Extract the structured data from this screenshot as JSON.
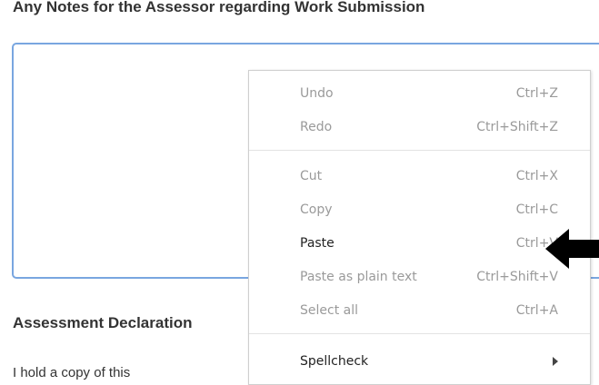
{
  "form": {
    "notes_heading": "Any Notes for the Assessor regarding Work Submission",
    "declaration_heading": "Assessment Declaration",
    "partial_text": "I hold a copy of this"
  },
  "context_menu": {
    "groups": [
      [
        {
          "label": "Undo",
          "shortcut": "Ctrl+Z",
          "enabled": false
        },
        {
          "label": "Redo",
          "shortcut": "Ctrl+Shift+Z",
          "enabled": false
        }
      ],
      [
        {
          "label": "Cut",
          "shortcut": "Ctrl+X",
          "enabled": false
        },
        {
          "label": "Copy",
          "shortcut": "Ctrl+C",
          "enabled": false
        },
        {
          "label": "Paste",
          "shortcut": "Ctrl+V",
          "enabled": true
        },
        {
          "label": "Paste as plain text",
          "shortcut": "Ctrl+Shift+V",
          "enabled": false
        },
        {
          "label": "Select all",
          "shortcut": "Ctrl+A",
          "enabled": false
        }
      ],
      [
        {
          "label": "Spellcheck",
          "shortcut": "",
          "enabled": true,
          "submenu": true
        }
      ]
    ]
  },
  "colors": {
    "textarea_border": "#79a6e0",
    "disabled_text": "#9a9a9a",
    "enabled_text": "#222222"
  },
  "icons": {
    "pointer": "black-left-arrow-icon"
  }
}
